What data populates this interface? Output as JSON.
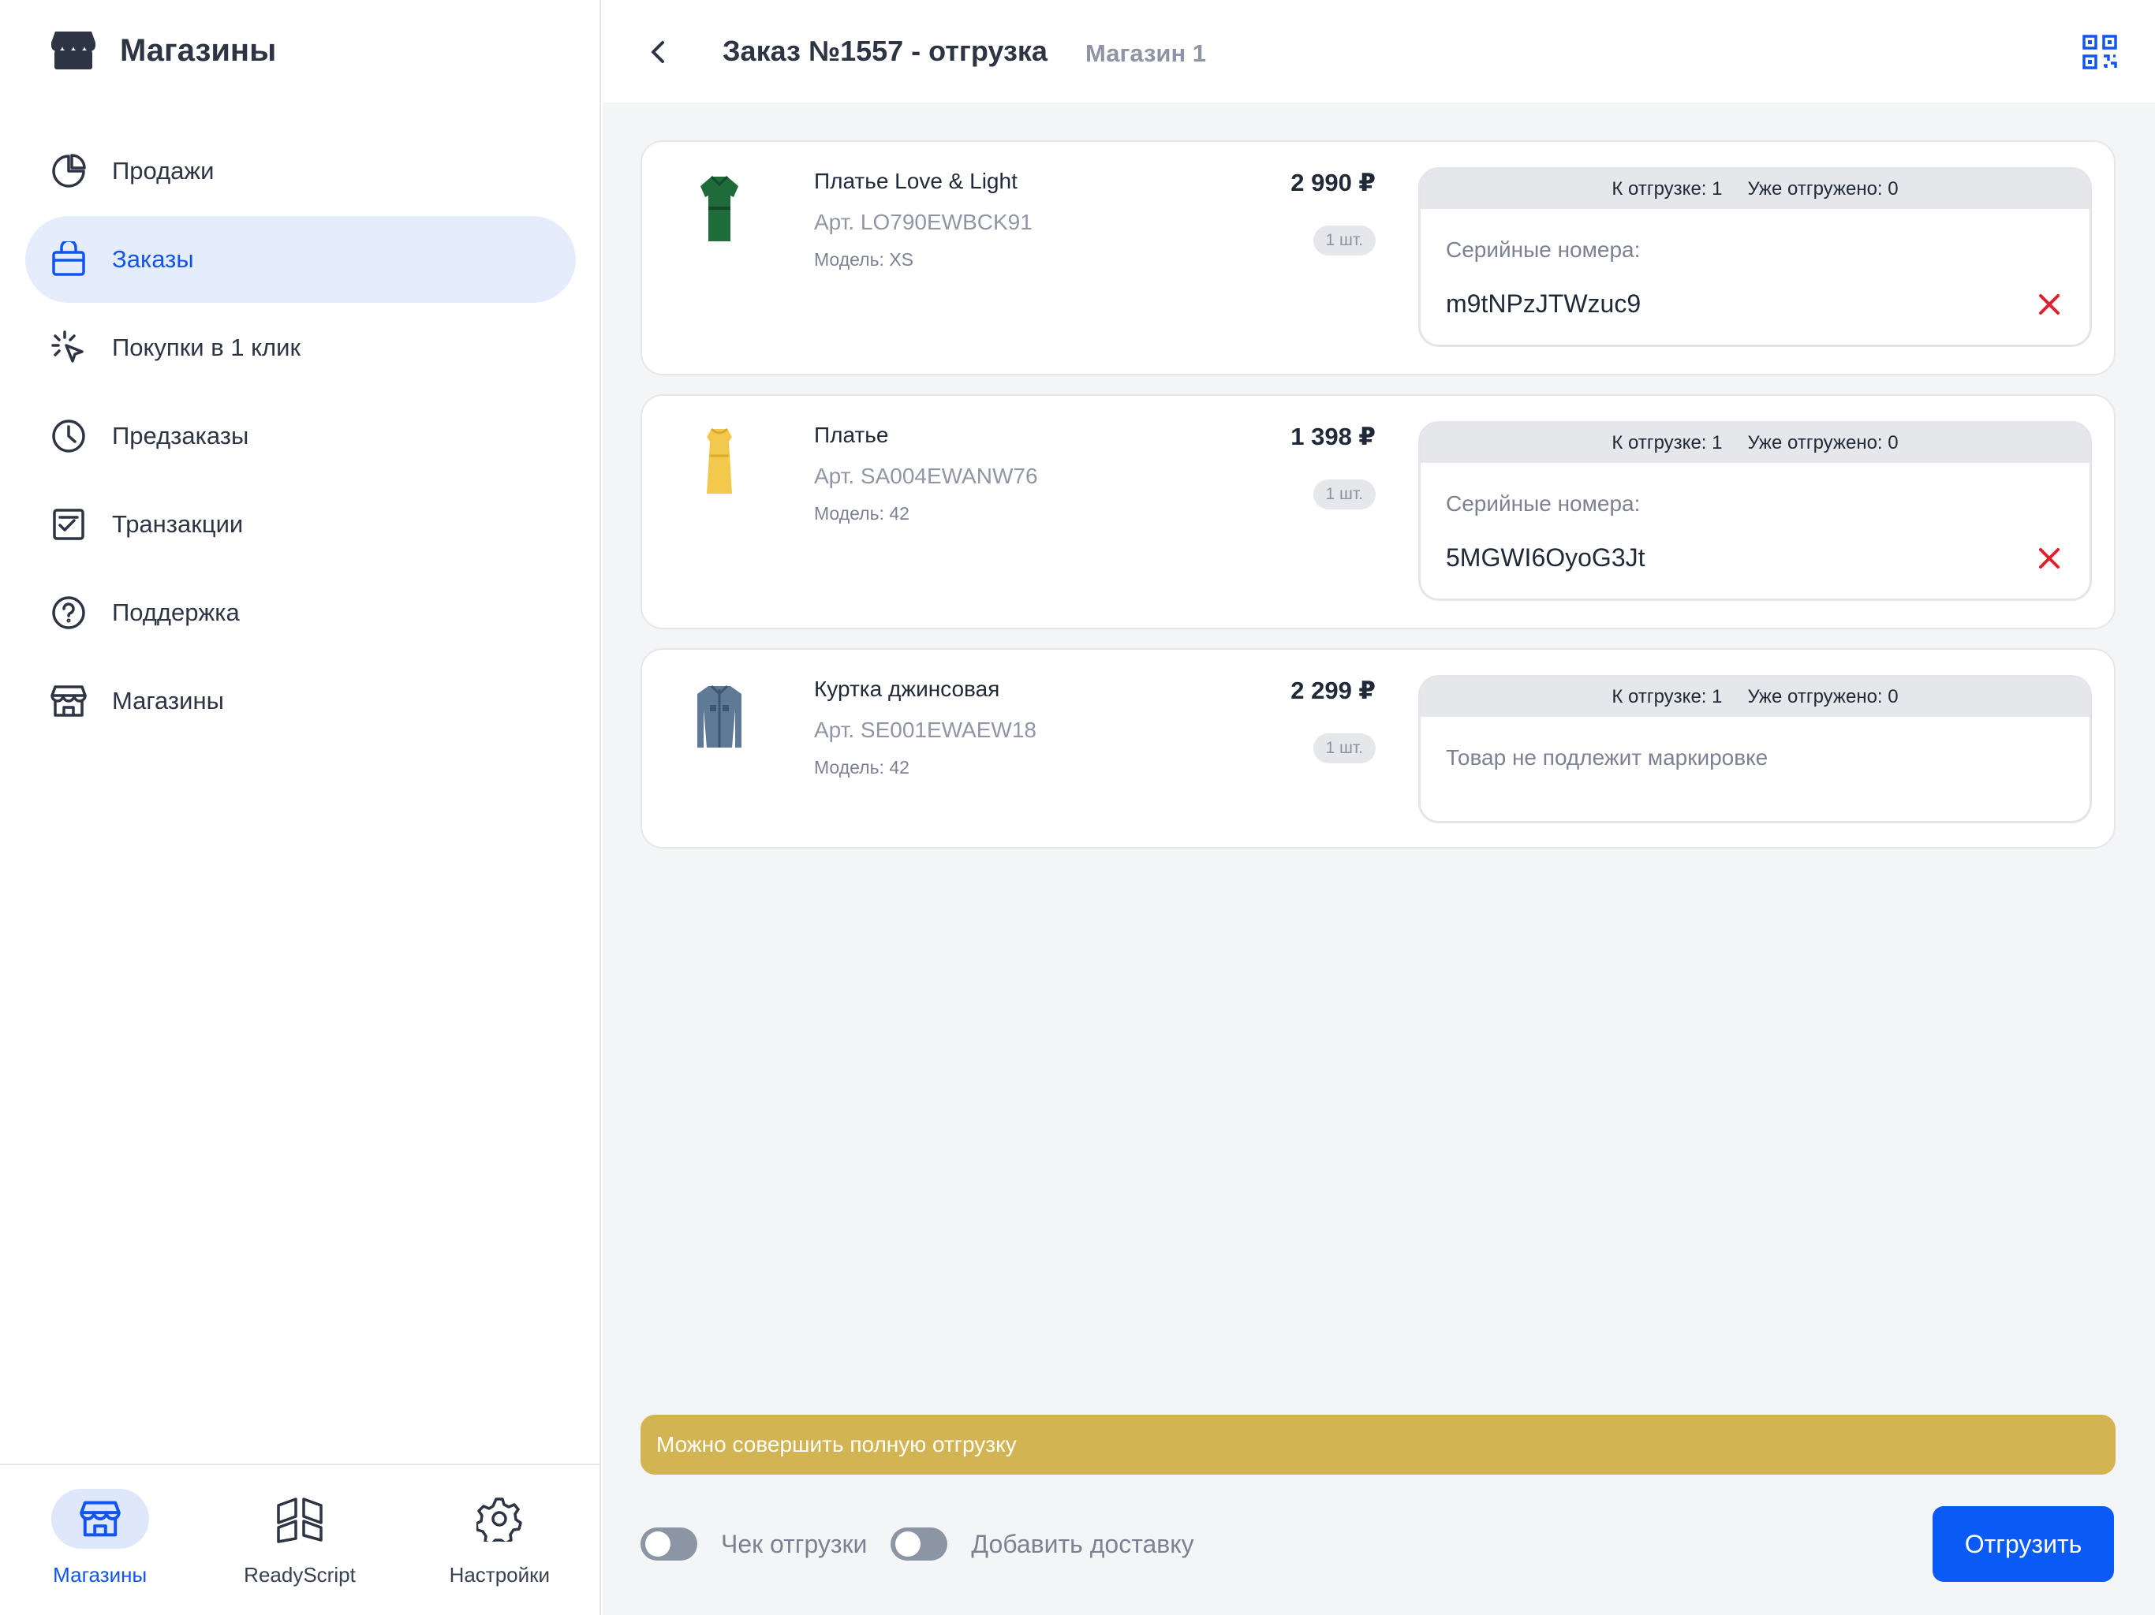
{
  "app": {
    "brand_title": "Магазины"
  },
  "sidebar": {
    "items": [
      {
        "label": "Продажи",
        "icon": "pie-chart-icon"
      },
      {
        "label": "Заказы",
        "icon": "bag-icon",
        "active": true
      },
      {
        "label": "Покупки в 1 клик",
        "icon": "click-icon"
      },
      {
        "label": "Предзаказы",
        "icon": "clock-icon"
      },
      {
        "label": "Транзакции",
        "icon": "checklist-icon"
      },
      {
        "label": "Поддержка",
        "icon": "help-icon"
      },
      {
        "label": "Магазины",
        "icon": "store-icon"
      }
    ]
  },
  "bottom_tabs": [
    {
      "label": "Магазины",
      "icon": "store-icon",
      "active": true
    },
    {
      "label": "ReadyScript",
      "icon": "readyscript-logo-icon"
    },
    {
      "label": "Настройки",
      "icon": "gear-icon"
    }
  ],
  "header": {
    "title": "Заказ №1557 - отгрузка",
    "subtitle": "Магазин 1"
  },
  "order_items": [
    {
      "name": "Платье Love & Light",
      "article": "Арт. LO790EWBCK91",
      "model": "Модель: XS",
      "price": "2 990 ₽",
      "qty": "1 шт.",
      "to_ship": "К отгрузке: 1",
      "shipped": "Уже отгружено: 0",
      "serial_title": "Серийные номера:",
      "serial": "m9tNPzJTWzuc9",
      "image": "green-dress",
      "image_color": "#1f6b3a"
    },
    {
      "name": "Платье",
      "article": "Арт. SA004EWANW76",
      "model": "Модель: 42",
      "price": "1 398 ₽",
      "qty": "1 шт.",
      "to_ship": "К отгрузке: 1",
      "shipped": "Уже отгружено: 0",
      "serial_title": "Серийные номера:",
      "serial": "5MGWI6OyoG3Jt",
      "image": "yellow-dress",
      "image_color": "#f2c94c"
    },
    {
      "name": "Куртка джинсовая",
      "article": "Арт. SE001EWAEW18",
      "model": "Модель: 42",
      "price": "2 299 ₽",
      "qty": "1 шт.",
      "to_ship": "К отгрузке: 1",
      "shipped": "Уже отгружено: 0",
      "note": "Товар не подлежит маркировке",
      "image": "denim-jacket",
      "image_color": "#5f7a96"
    }
  ],
  "footer": {
    "notice": "Можно совершить полную отгрузку",
    "toggle_receipt": "Чек отгрузки",
    "toggle_delivery": "Добавить доставку",
    "ship_button": "Отгрузить"
  },
  "colors": {
    "accent": "#0a5af5",
    "notice": "#d3b453",
    "delete": "#e0202c"
  }
}
